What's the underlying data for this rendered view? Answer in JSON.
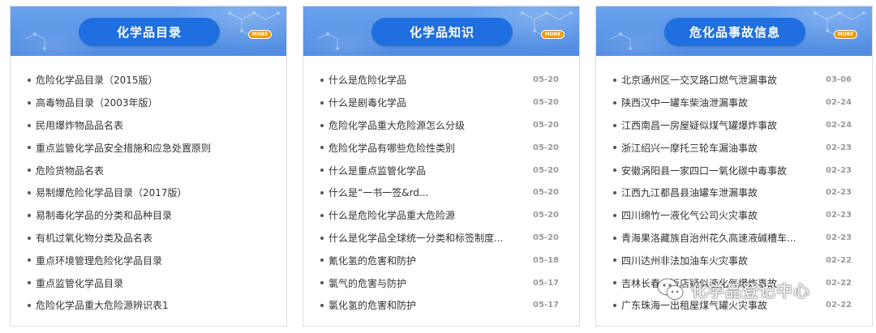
{
  "panels": [
    {
      "title": "化学品目录",
      "more_label": "MORE",
      "items": [
        {
          "text": "危险化学品目录（2015版）",
          "date": ""
        },
        {
          "text": "高毒物品目录（2003年版）",
          "date": ""
        },
        {
          "text": "民用爆炸物品品名表",
          "date": ""
        },
        {
          "text": "重点监管化学品安全措施和应急处置原则",
          "date": ""
        },
        {
          "text": "危险货物品名表",
          "date": ""
        },
        {
          "text": "易制爆危险化学品目录（2017版）",
          "date": ""
        },
        {
          "text": "易制毒化学品的分类和品种目录",
          "date": ""
        },
        {
          "text": "有机过氧化物分类及品名表",
          "date": ""
        },
        {
          "text": "重点环境管理危险化学品目录",
          "date": ""
        },
        {
          "text": "重点监管化学品目录",
          "date": ""
        },
        {
          "text": "危险化学品重大危险源辨识表1",
          "date": ""
        }
      ]
    },
    {
      "title": "化学品知识",
      "more_label": "MORE",
      "items": [
        {
          "text": "什么是危险化学品",
          "date": "05-20"
        },
        {
          "text": "什么是剧毒化学品",
          "date": "05-20"
        },
        {
          "text": "危险化学品重大危险源怎么分级",
          "date": "05-20"
        },
        {
          "text": "危险化学品有哪些危险性类别",
          "date": "05-20"
        },
        {
          "text": "什么是重点监管化学品",
          "date": "05-20"
        },
        {
          "text": "什么是“一书一签&rd...",
          "date": "05-20"
        },
        {
          "text": "什么是危险化学品重大危险源",
          "date": "05-20"
        },
        {
          "text": "什么是化学品全球统一分类和标签制度...",
          "date": "05-20"
        },
        {
          "text": "氰化氢的危害和防护",
          "date": "05-18"
        },
        {
          "text": "氯气的危害与防护",
          "date": "05-17"
        },
        {
          "text": "氯化氢的危害和防护",
          "date": "05-17"
        }
      ]
    },
    {
      "title": "危化品事故信息",
      "more_label": "MORE",
      "items": [
        {
          "text": "北京通州区一交叉路口燃气泄漏事故",
          "date": "03-06"
        },
        {
          "text": "陕西汉中一罐车柴油泄漏事故",
          "date": "02-24"
        },
        {
          "text": "江西南昌一房屋疑似煤气罐爆炸事故",
          "date": "02-24"
        },
        {
          "text": "浙江绍兴一摩托三轮车漏油事故",
          "date": "02-23"
        },
        {
          "text": "安徽涡阳县一家四口一氧化碳中毒事故",
          "date": "02-23"
        },
        {
          "text": "江西九江都昌县油罐车泄漏事故",
          "date": "02-23"
        },
        {
          "text": "四川绵竹一液化气公司火灾事故",
          "date": "02-23"
        },
        {
          "text": "青海果洛藏族自治州花久高速液碱槽车...",
          "date": "02-23"
        },
        {
          "text": "四川达州非法加油车火灾事故",
          "date": "02-22"
        },
        {
          "text": "吉林长春一饭店疑似液化气爆炸事故",
          "date": "02-22"
        },
        {
          "text": "广东珠海一出租屋煤气罐火灾事故",
          "date": "02-22"
        }
      ]
    }
  ],
  "watermark": {
    "text": "化学品登记中心",
    "icon": "wechat-icon"
  },
  "colors": {
    "header_bg": "#5c96e8",
    "pill_bg": "#1f6fe0",
    "more_badge": "#f39800",
    "item_text": "#333333",
    "date_text": "#9a9a9a"
  }
}
